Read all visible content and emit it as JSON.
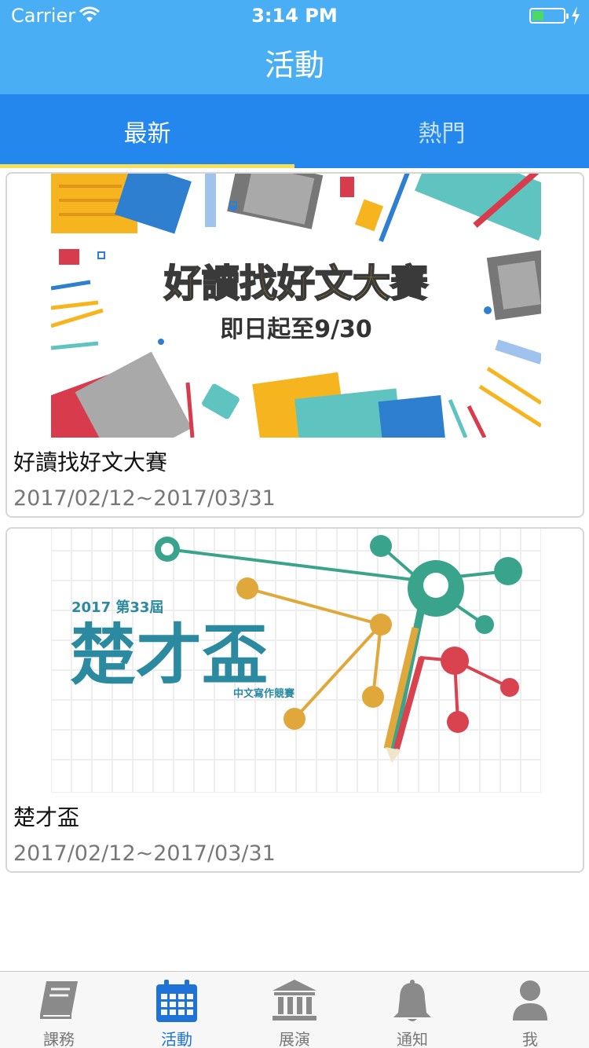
{
  "status_bar": {
    "carrier": "Carrier",
    "time": "3:14 PM"
  },
  "nav": {
    "title": "活動"
  },
  "tabs": [
    {
      "label": "最新",
      "active": true
    },
    {
      "label": "熱門",
      "active": false
    }
  ],
  "activities": [
    {
      "title": "好讀找好文大賽",
      "date_range": "2017/02/12~2017/03/31",
      "banner": {
        "headline": "好讀找好文大賽",
        "subline": "即日起至9/30"
      }
    },
    {
      "title": "楚才盃",
      "date_range": "2017/02/12~2017/03/31",
      "banner": {
        "year_edition": "2017 第33屆",
        "headline": "楚才盃",
        "subline": "中文寫作競賽"
      }
    }
  ],
  "tab_bar": [
    {
      "label": "課務",
      "icon": "book-icon",
      "active": false
    },
    {
      "label": "活動",
      "icon": "calendar-icon",
      "active": true
    },
    {
      "label": "展演",
      "icon": "museum-icon",
      "active": false
    },
    {
      "label": "通知",
      "icon": "bell-icon",
      "active": false
    },
    {
      "label": "我",
      "icon": "person-icon",
      "active": false
    }
  ],
  "colors": {
    "nav_blue": "#49aef3",
    "tab_blue": "#2487ee",
    "tab_indicator": "#f5e05a",
    "active_tab_icon": "#1f72d6"
  }
}
